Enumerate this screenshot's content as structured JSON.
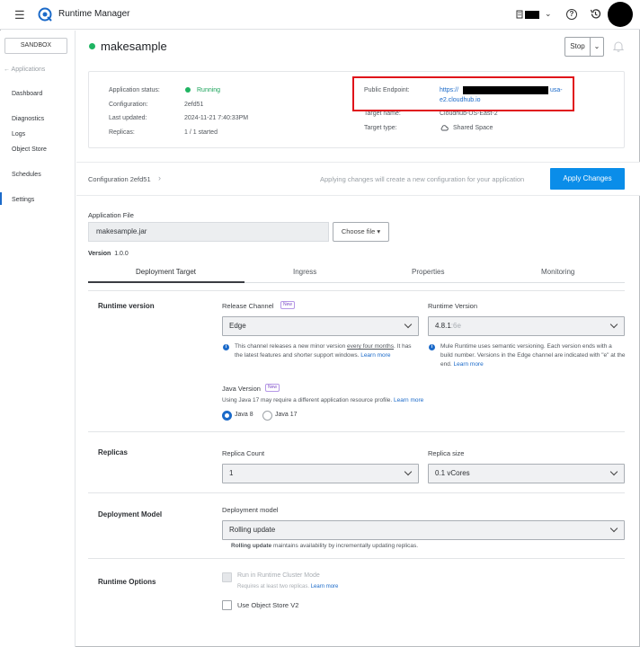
{
  "topbar": {
    "menu_icon": "hamburger-icon",
    "app_title": "Runtime Manager"
  },
  "sidebar": {
    "environment": "SANDBOX",
    "back_link": "← Applications",
    "items": [
      {
        "label": "Dashboard"
      },
      {
        "label": "Diagnostics"
      },
      {
        "label": "Logs"
      },
      {
        "label": "Object Store"
      },
      {
        "label": "Schedules"
      },
      {
        "label": "Settings"
      }
    ]
  },
  "app": {
    "name": "makesample",
    "stop_label": "Stop",
    "status_label": "Application status:",
    "status_value": "Running",
    "config_label": "Configuration:",
    "config_value": "2efd51",
    "updated_label": "Last updated:",
    "updated_value": "2024-11-21 7:40:33PM",
    "replicas_label": "Replicas:",
    "replicas_value": "1 / 1 started",
    "endpoint_label": "Public Endpoint:",
    "endpoint_prefix": "https://",
    "endpoint_suffix": "usa-",
    "endpoint_line2": "e2.cloudhub.io",
    "target_name_label": "Target name:",
    "target_name_value": "Cloudhub-US-East-2",
    "target_type_label": "Target type:",
    "target_type_value": "Shared Space"
  },
  "config_bar": {
    "label": "Configuration 2efd51",
    "note": "Applying changes will create a new configuration for your application",
    "apply_label": "Apply Changes"
  },
  "app_file": {
    "label": "Application File",
    "value": "makesample.jar",
    "choose_label": "Choose file ▾",
    "version_label": "Version",
    "version_value": "1.0.0"
  },
  "tabs": [
    "Deployment Target",
    "Ingress",
    "Properties",
    "Monitoring"
  ],
  "runtime": {
    "title": "Runtime version",
    "channel_label": "Release Channel",
    "new_badge": "New",
    "channel_value": "Edge",
    "channel_help_1": "This channel releases a new minor version ",
    "channel_help_link": "every four months",
    "channel_help_2": ". It has the latest features and shorter support windows. ",
    "learn_more": "Learn more",
    "runtime_version_label": "Runtime Version",
    "runtime_version_value": "4.8.1",
    "runtime_version_suffix": ":6e",
    "runtime_help": "Mule Runtime uses semantic versioning. Each version ends with a build number. Versions in the Edge channel are indicated with \"e\" at the end. ",
    "java_label": "Java Version",
    "java_help": "Using Java 17 may require a different application resource profile. ",
    "java8": "Java 8",
    "java17": "Java 17"
  },
  "replicas": {
    "title": "Replicas",
    "count_label": "Replica Count",
    "count_value": "1",
    "size_label": "Replica size",
    "size_value": "0.1 vCores"
  },
  "deployment": {
    "title": "Deployment Model",
    "model_label": "Deployment model",
    "model_value": "Rolling update",
    "help_bold": "Rolling update",
    "help_rest": " maintains availability by incrementally updating replicas."
  },
  "options": {
    "title": "Runtime Options",
    "cluster_label": "Run in Runtime Cluster Mode",
    "cluster_help": "Requires at least two replicas. ",
    "object_store_label": "Use Object Store V2"
  },
  "colors": {
    "accent": "#0a8de9",
    "running": "#1fb462",
    "highlight_box": "#e0131a"
  }
}
